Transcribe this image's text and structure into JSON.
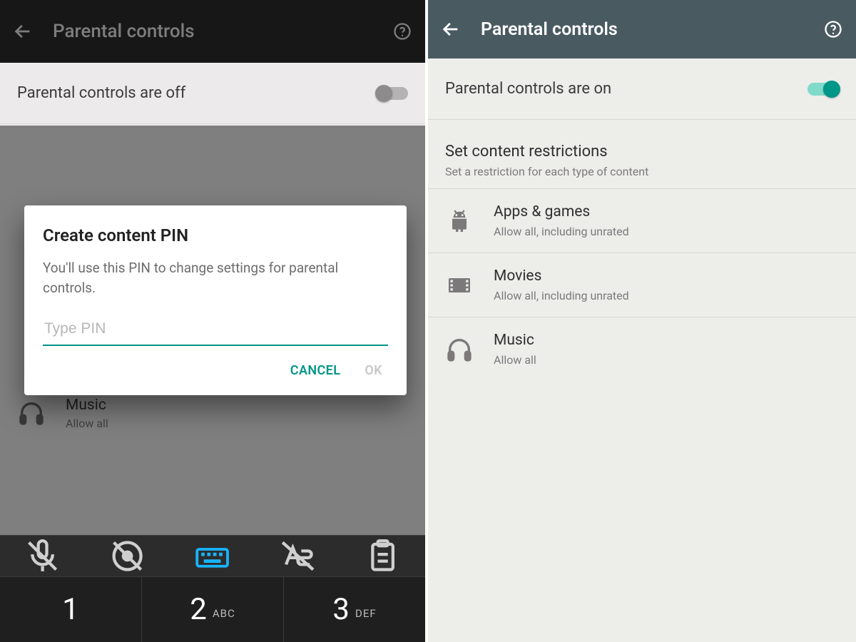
{
  "left": {
    "header": {
      "title": "Parental controls"
    },
    "toggle_label": "Parental controls are off",
    "music_row": {
      "title": "Music",
      "subtitle": "Allow all"
    },
    "dialog": {
      "title": "Create content PIN",
      "body": "You'll use this PIN to change settings for parental controls.",
      "placeholder": "Type PIN",
      "cancel": "CANCEL",
      "ok": "OK"
    },
    "keypad": {
      "1": {
        "digit": "1",
        "sub": ""
      },
      "2": {
        "digit": "2",
        "sub": "ABC"
      },
      "3": {
        "digit": "3",
        "sub": "DEF"
      }
    }
  },
  "right": {
    "header": {
      "title": "Parental controls"
    },
    "toggle_label": "Parental controls are on",
    "section": {
      "title": "Set content restrictions",
      "subtitle": "Set a restriction for each type of content"
    },
    "items": [
      {
        "title": "Apps & games",
        "subtitle": "Allow all, including unrated"
      },
      {
        "title": "Movies",
        "subtitle": "Allow all, including unrated"
      },
      {
        "title": "Music",
        "subtitle": "Allow all"
      }
    ]
  },
  "colors": {
    "accent": "#009688"
  }
}
